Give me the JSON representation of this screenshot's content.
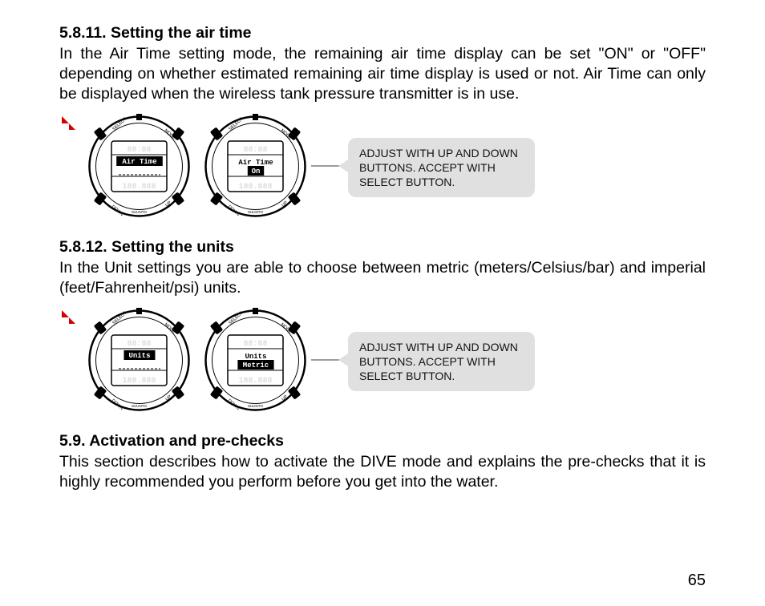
{
  "page_number": "65",
  "sections": [
    {
      "id": "s1",
      "heading": "5.8.11. Setting the air time",
      "para": "In the Air Time setting mode, the remaining air time display can be set \"ON\" or \"OFF\" depending on whether estimated remaining air time display is used or not. Air Time can only be displayed when the wireless tank pressure transmitter is in use.",
      "watch1_line1": "Air Time",
      "watch1_line2": "",
      "watch2_line1": "Air Time",
      "watch2_line2": "On",
      "callout": "ADJUST WITH UP AND DOWN BUTTONS.  ACCEPT WITH SELECT BUTTON."
    },
    {
      "id": "s2",
      "heading": "5.8.12. Setting the units",
      "para": "In the Unit settings you are able to choose between metric (meters/Celsius/bar) and imperial (feet/Fahrenheit/psi) units.",
      "watch1_line1": "Units",
      "watch1_line2": "",
      "watch2_line1": "Units",
      "watch2_line2": "Metric",
      "callout": "ADJUST WITH UP AND DOWN BUTTONS. ACCEPT WITH SELECT BUTTON."
    },
    {
      "id": "s3",
      "heading": "5.9. Activation and pre-checks",
      "para": "This section describes how to activate the DIVE mode and explains the pre-checks that it is highly recommended you perform before you get into the water."
    }
  ],
  "watch_labels": {
    "select": "SELECT",
    "mode": "MODE",
    "down": "DOWN",
    "up": "UP",
    "brand": "SUUNTO"
  }
}
